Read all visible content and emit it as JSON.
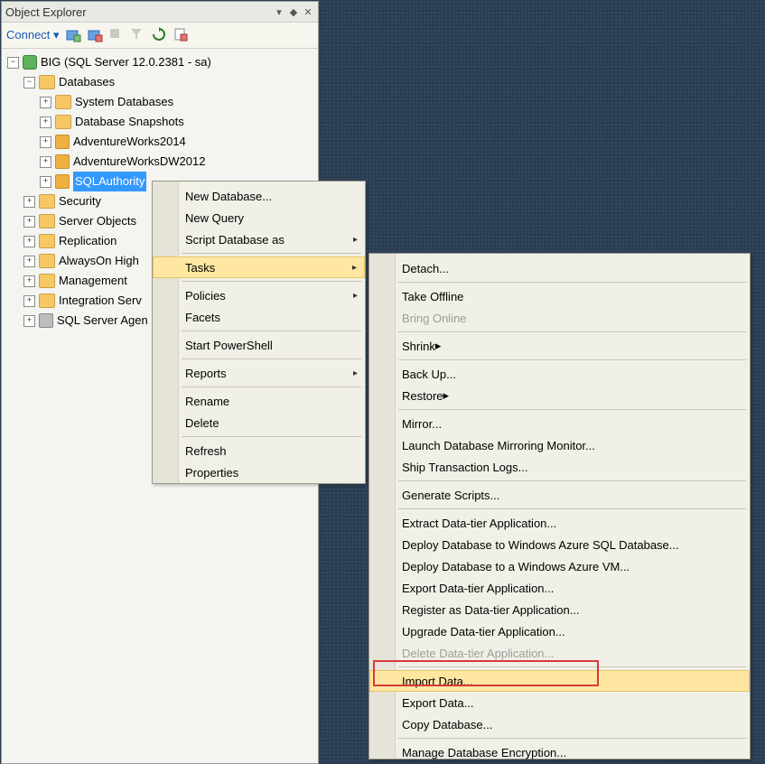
{
  "panel": {
    "title": "Object Explorer"
  },
  "toolbar": {
    "connect": "Connect",
    "dropdown": "▾"
  },
  "tree": {
    "server": "BIG (SQL Server 12.0.2381 - sa)",
    "databases": "Databases",
    "sysdb": "System Databases",
    "snapshots": "Database Snapshots",
    "aw2014": "AdventureWorks2014",
    "awdw2012": "AdventureWorksDW2012",
    "sqlauth": "SQLAuthority",
    "security": "Security",
    "serverobj": "Server Objects",
    "replication": "Replication",
    "alwayson": "AlwaysOn High",
    "management": "Management",
    "integ": "Integration Serv",
    "agent": "SQL Server Agen"
  },
  "menu1": {
    "newdb": "New Database...",
    "newq": "New Query",
    "scriptdb": "Script Database as",
    "tasks": "Tasks",
    "policies": "Policies",
    "facets": "Facets",
    "startps": "Start PowerShell",
    "reports": "Reports",
    "rename": "Rename",
    "delete": "Delete",
    "refresh": "Refresh",
    "properties": "Properties"
  },
  "menu2": {
    "detach": "Detach...",
    "takeoff": "Take Offline",
    "bringon": "Bring Online",
    "shrink": "Shrink",
    "backup": "Back Up...",
    "restore": "Restore",
    "mirror": "Mirror...",
    "launchmirror": "Launch Database Mirroring Monitor...",
    "shiptx": "Ship Transaction Logs...",
    "genscr": "Generate Scripts...",
    "extdt": "Extract Data-tier Application...",
    "depdbazsql": "Deploy Database to Windows Azure SQL Database...",
    "depdbazvm": "Deploy Database to a Windows Azure VM...",
    "expdt": "Export Data-tier Application...",
    "regdt": "Register as Data-tier Application...",
    "upgdt": "Upgrade Data-tier Application...",
    "deldt": "Delete Data-tier Application...",
    "impdata": "Import Data...",
    "expdata": "Export Data...",
    "copydb": "Copy Database...",
    "mde": "Manage Database Encryption..."
  },
  "glyph": {
    "plus": "+",
    "minus": "−",
    "arrow": "▸",
    "dd": "▾",
    "pin": "◆",
    "x": "✕"
  }
}
